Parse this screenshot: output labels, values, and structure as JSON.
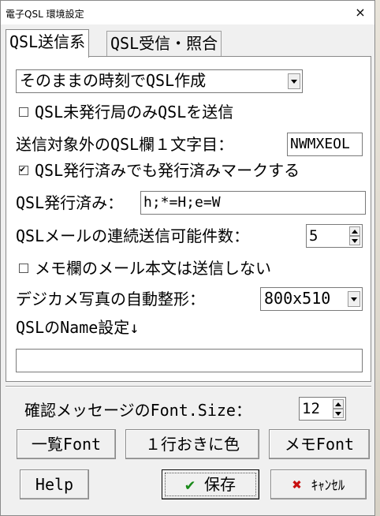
{
  "window": {
    "title": "電子QSL 環境設定",
    "close_glyph": "×"
  },
  "tabs": [
    {
      "label": "QSL送信系"
    },
    {
      "label": "QSL受信・照合"
    }
  ],
  "send_tab": {
    "time_mode_select": "そのままの時刻でQSL作成",
    "unissued_only_label": "QSL未発行局のみQSLを送信",
    "unissued_only_checked": false,
    "exclude_first_char_label": "送信対象外のQSL欄１文字目：",
    "exclude_first_char_value": "NWMXEOL",
    "issued_mark_label": "QSL発行済みでも発行済みマークする",
    "issued_mark_checked": true,
    "issued_label": "QSL発行済み：",
    "issued_value": "h;*=H;e=W",
    "mail_count_label": "QSLメールの連続送信可能件数：",
    "mail_count_value": "5",
    "memo_no_send_label": "メモ欄のメール本文は送信しない",
    "memo_no_send_checked": false,
    "photo_resize_label": "デジカメ写真の自動整形：",
    "photo_resize_value": "800x510",
    "name_setting_label": "QSLのName設定↓",
    "name_setting_value": ""
  },
  "footer": {
    "font_size_label": "確認メッセージのFont.Size：",
    "font_size_value": "12",
    "list_font_button": "一覧Font",
    "alt_color_button": "１行おきに色",
    "memo_font_button": "メモFont",
    "help_button": "Help",
    "save_check": "✔",
    "save_button": "保存",
    "cancel_x": "✖",
    "cancel_button": "ｷｬﾝｾﾙ"
  }
}
